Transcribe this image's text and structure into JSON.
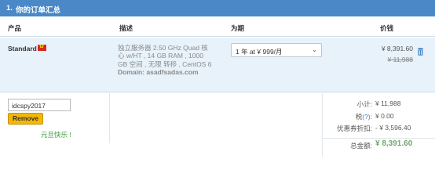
{
  "section": {
    "number": "1.",
    "title": "你的订单汇总"
  },
  "columns": {
    "product": "产品",
    "description": "描述",
    "period": "为期",
    "price": "价钱"
  },
  "item": {
    "name": "Standard",
    "flag_icon": "hong-kong-flag",
    "description": "独立服务器 2.50 GHz Quad 核心 w/HT , 14 GB RAM , 1000 GB 空间 , 无限 转移 , CentOS 6",
    "domain_label": "Domain:",
    "domain": "asadfsadas.com",
    "period_selected": "1 年 at ¥ 999/月",
    "price": "¥ 8,391.60",
    "original_price": "¥ 11,988"
  },
  "coupon": {
    "code": "idcspy2017",
    "remove_label": "Remove",
    "promo_text": "元旦快乐 !"
  },
  "summary": {
    "subtotal_label": "小计:",
    "subtotal_value": "¥ 11,988",
    "tax_label": "税",
    "tax_help": "(?)",
    "tax_colon": ":",
    "tax_value": "¥ 0.00",
    "discount_label": "优惠券折扣:",
    "discount_value": "- ¥ 3,596.40",
    "total_label": "总金额:",
    "total_value": "¥ 8,391.60"
  },
  "colors": {
    "header_bg": "#4a88c8",
    "row_bg": "#e8f2fa",
    "button": "#f5b800",
    "total": "#6fa86f"
  }
}
